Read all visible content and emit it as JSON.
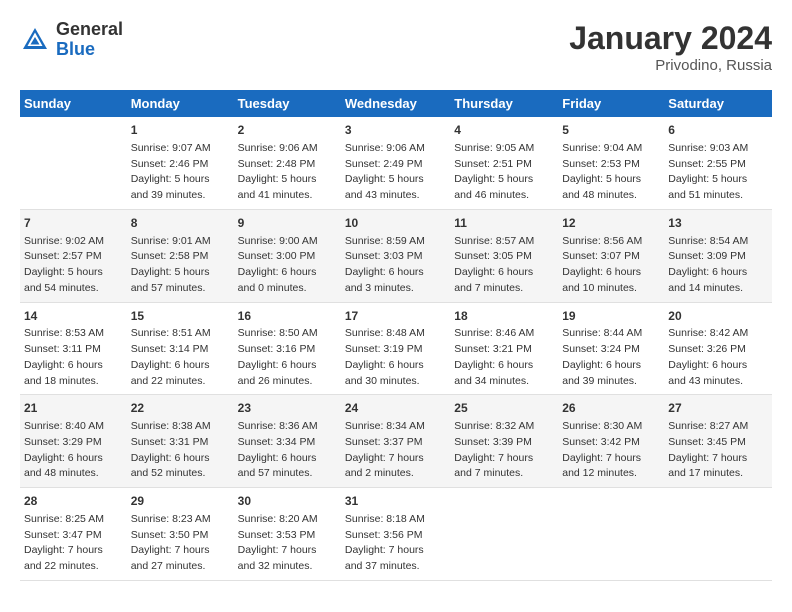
{
  "header": {
    "logo_general": "General",
    "logo_blue": "Blue",
    "month_year": "January 2024",
    "location": "Privodino, Russia"
  },
  "days_of_week": [
    "Sunday",
    "Monday",
    "Tuesday",
    "Wednesday",
    "Thursday",
    "Friday",
    "Saturday"
  ],
  "weeks": [
    [
      {
        "day": "",
        "content": ""
      },
      {
        "day": "1",
        "content": "Sunrise: 9:07 AM\nSunset: 2:46 PM\nDaylight: 5 hours\nand 39 minutes."
      },
      {
        "day": "2",
        "content": "Sunrise: 9:06 AM\nSunset: 2:48 PM\nDaylight: 5 hours\nand 41 minutes."
      },
      {
        "day": "3",
        "content": "Sunrise: 9:06 AM\nSunset: 2:49 PM\nDaylight: 5 hours\nand 43 minutes."
      },
      {
        "day": "4",
        "content": "Sunrise: 9:05 AM\nSunset: 2:51 PM\nDaylight: 5 hours\nand 46 minutes."
      },
      {
        "day": "5",
        "content": "Sunrise: 9:04 AM\nSunset: 2:53 PM\nDaylight: 5 hours\nand 48 minutes."
      },
      {
        "day": "6",
        "content": "Sunrise: 9:03 AM\nSunset: 2:55 PM\nDaylight: 5 hours\nand 51 minutes."
      }
    ],
    [
      {
        "day": "7",
        "content": "Sunrise: 9:02 AM\nSunset: 2:57 PM\nDaylight: 5 hours\nand 54 minutes."
      },
      {
        "day": "8",
        "content": "Sunrise: 9:01 AM\nSunset: 2:58 PM\nDaylight: 5 hours\nand 57 minutes."
      },
      {
        "day": "9",
        "content": "Sunrise: 9:00 AM\nSunset: 3:00 PM\nDaylight: 6 hours\nand 0 minutes."
      },
      {
        "day": "10",
        "content": "Sunrise: 8:59 AM\nSunset: 3:03 PM\nDaylight: 6 hours\nand 3 minutes."
      },
      {
        "day": "11",
        "content": "Sunrise: 8:57 AM\nSunset: 3:05 PM\nDaylight: 6 hours\nand 7 minutes."
      },
      {
        "day": "12",
        "content": "Sunrise: 8:56 AM\nSunset: 3:07 PM\nDaylight: 6 hours\nand 10 minutes."
      },
      {
        "day": "13",
        "content": "Sunrise: 8:54 AM\nSunset: 3:09 PM\nDaylight: 6 hours\nand 14 minutes."
      }
    ],
    [
      {
        "day": "14",
        "content": "Sunrise: 8:53 AM\nSunset: 3:11 PM\nDaylight: 6 hours\nand 18 minutes."
      },
      {
        "day": "15",
        "content": "Sunrise: 8:51 AM\nSunset: 3:14 PM\nDaylight: 6 hours\nand 22 minutes."
      },
      {
        "day": "16",
        "content": "Sunrise: 8:50 AM\nSunset: 3:16 PM\nDaylight: 6 hours\nand 26 minutes."
      },
      {
        "day": "17",
        "content": "Sunrise: 8:48 AM\nSunset: 3:19 PM\nDaylight: 6 hours\nand 30 minutes."
      },
      {
        "day": "18",
        "content": "Sunrise: 8:46 AM\nSunset: 3:21 PM\nDaylight: 6 hours\nand 34 minutes."
      },
      {
        "day": "19",
        "content": "Sunrise: 8:44 AM\nSunset: 3:24 PM\nDaylight: 6 hours\nand 39 minutes."
      },
      {
        "day": "20",
        "content": "Sunrise: 8:42 AM\nSunset: 3:26 PM\nDaylight: 6 hours\nand 43 minutes."
      }
    ],
    [
      {
        "day": "21",
        "content": "Sunrise: 8:40 AM\nSunset: 3:29 PM\nDaylight: 6 hours\nand 48 minutes."
      },
      {
        "day": "22",
        "content": "Sunrise: 8:38 AM\nSunset: 3:31 PM\nDaylight: 6 hours\nand 52 minutes."
      },
      {
        "day": "23",
        "content": "Sunrise: 8:36 AM\nSunset: 3:34 PM\nDaylight: 6 hours\nand 57 minutes."
      },
      {
        "day": "24",
        "content": "Sunrise: 8:34 AM\nSunset: 3:37 PM\nDaylight: 7 hours\nand 2 minutes."
      },
      {
        "day": "25",
        "content": "Sunrise: 8:32 AM\nSunset: 3:39 PM\nDaylight: 7 hours\nand 7 minutes."
      },
      {
        "day": "26",
        "content": "Sunrise: 8:30 AM\nSunset: 3:42 PM\nDaylight: 7 hours\nand 12 minutes."
      },
      {
        "day": "27",
        "content": "Sunrise: 8:27 AM\nSunset: 3:45 PM\nDaylight: 7 hours\nand 17 minutes."
      }
    ],
    [
      {
        "day": "28",
        "content": "Sunrise: 8:25 AM\nSunset: 3:47 PM\nDaylight: 7 hours\nand 22 minutes."
      },
      {
        "day": "29",
        "content": "Sunrise: 8:23 AM\nSunset: 3:50 PM\nDaylight: 7 hours\nand 27 minutes."
      },
      {
        "day": "30",
        "content": "Sunrise: 8:20 AM\nSunset: 3:53 PM\nDaylight: 7 hours\nand 32 minutes."
      },
      {
        "day": "31",
        "content": "Sunrise: 8:18 AM\nSunset: 3:56 PM\nDaylight: 7 hours\nand 37 minutes."
      },
      {
        "day": "",
        "content": ""
      },
      {
        "day": "",
        "content": ""
      },
      {
        "day": "",
        "content": ""
      }
    ]
  ]
}
